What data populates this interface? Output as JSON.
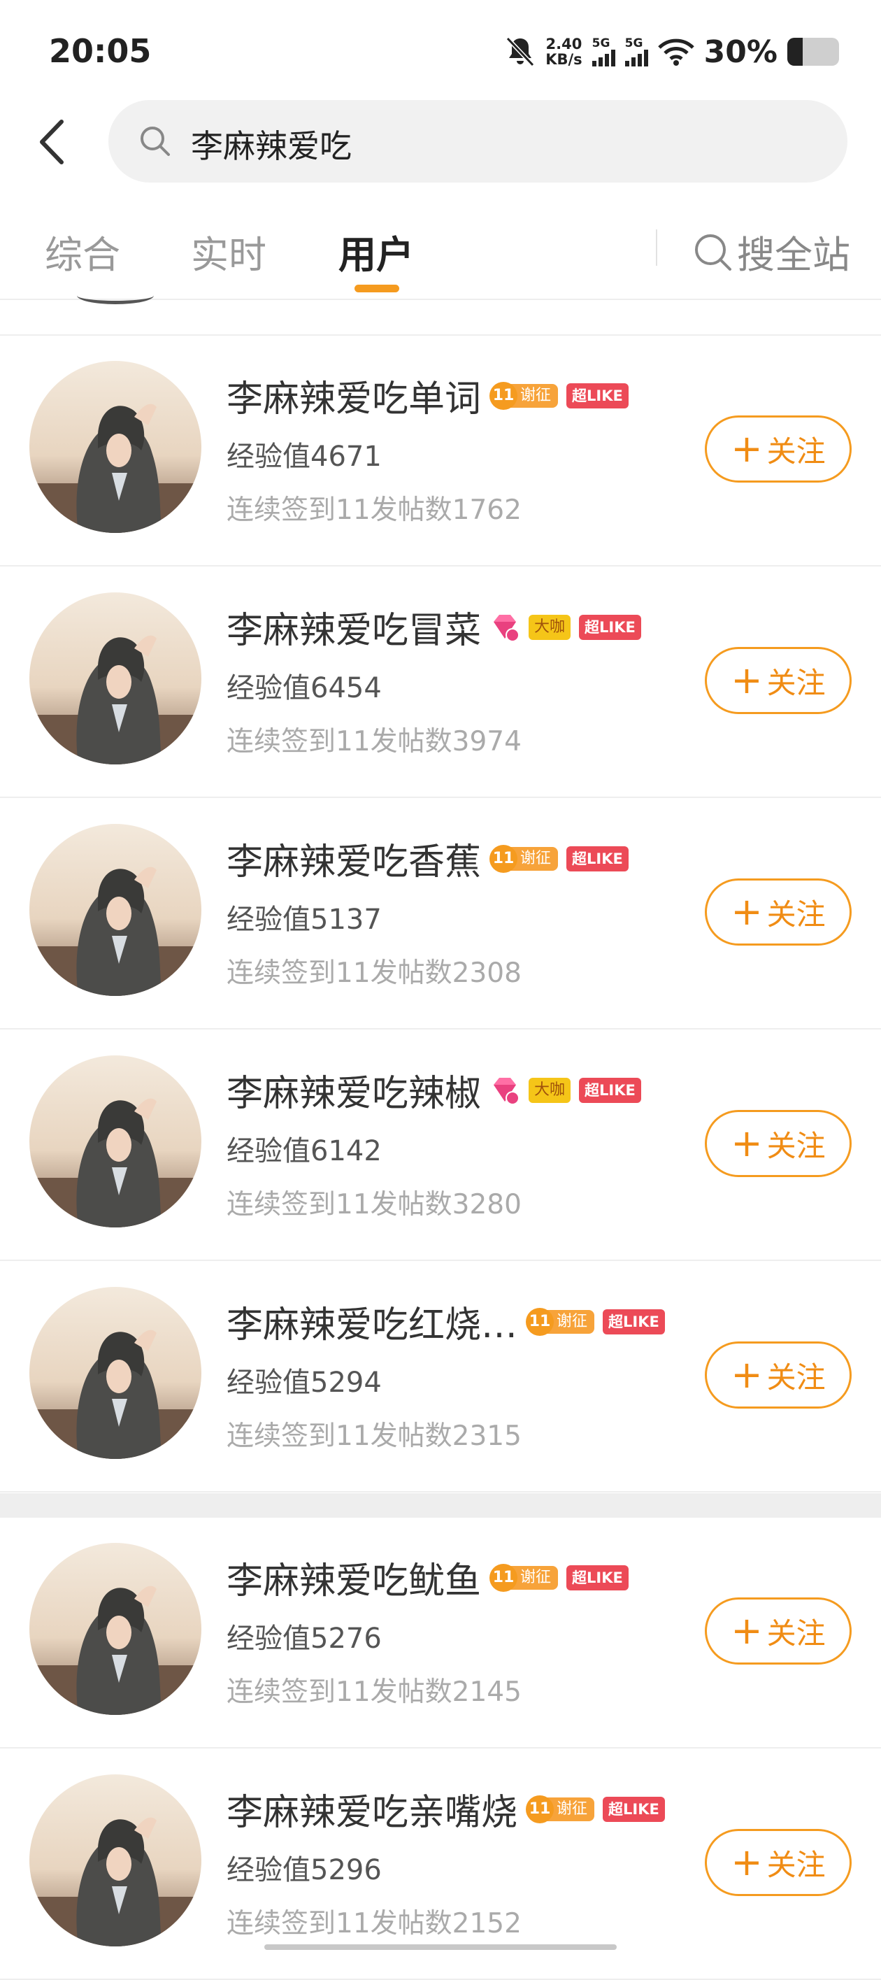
{
  "status_bar": {
    "time": "20:05",
    "speed_value": "2.40",
    "speed_unit": "KB/s",
    "sim1_label": "5G",
    "sim2_label": "5G",
    "battery_percent": "30%",
    "battery_level": 0.3,
    "icons": [
      "bell-muted-icon",
      "signal-icon",
      "wifi-icon",
      "battery-icon"
    ]
  },
  "header": {
    "search_query": "李麻辣爱吃"
  },
  "tabs": {
    "items": [
      {
        "label": "综合",
        "active": false
      },
      {
        "label": "实时",
        "active": false
      },
      {
        "label": "用户",
        "active": true
      }
    ],
    "site_search_label": "搜全站"
  },
  "follow_label": "关注",
  "follow_plus": "+",
  "accent_color": "#f59b1f",
  "users": [
    {
      "name": "李麻辣爱吃单词",
      "badges": [
        "v",
        "like"
      ],
      "badge_v_num": "11",
      "badge_v_text": "谢征",
      "like_text": "超LIKE",
      "exp": "经验值4671",
      "stats": "连续签到11发帖数1762"
    },
    {
      "name": "李麻辣爱吃冒菜",
      "badges": [
        "gem",
        "daka",
        "like"
      ],
      "daka_text": "大咖",
      "like_text": "超LIKE",
      "exp": "经验值6454",
      "stats": "连续签到11发帖数3974"
    },
    {
      "name": "李麻辣爱吃香蕉",
      "badges": [
        "v",
        "like"
      ],
      "badge_v_num": "11",
      "badge_v_text": "谢征",
      "like_text": "超LIKE",
      "exp": "经验值5137",
      "stats": "连续签到11发帖数2308"
    },
    {
      "name": "李麻辣爱吃辣椒",
      "badges": [
        "gem",
        "daka",
        "like"
      ],
      "daka_text": "大咖",
      "like_text": "超LIKE",
      "exp": "经验值6142",
      "stats": "连续签到11发帖数3280"
    },
    {
      "name": "李麻辣爱吃红烧…",
      "badges": [
        "v",
        "like"
      ],
      "badge_v_num": "11",
      "badge_v_text": "谢征",
      "like_text": "超LIKE",
      "exp": "经验值5294",
      "stats": "连续签到11发帖数2315"
    },
    {
      "name": "李麻辣爱吃鱿鱼",
      "badges": [
        "v",
        "like"
      ],
      "badge_v_num": "11",
      "badge_v_text": "谢征",
      "like_text": "超LIKE",
      "exp": "经验值5276",
      "stats": "连续签到11发帖数2145"
    },
    {
      "name": "李麻辣爱吃亲嘴烧",
      "badges": [
        "v",
        "like"
      ],
      "badge_v_num": "11",
      "badge_v_text": "谢征",
      "like_text": "超LIKE",
      "exp": "经验值5296",
      "stats": "连续签到11发帖数2152"
    }
  ]
}
